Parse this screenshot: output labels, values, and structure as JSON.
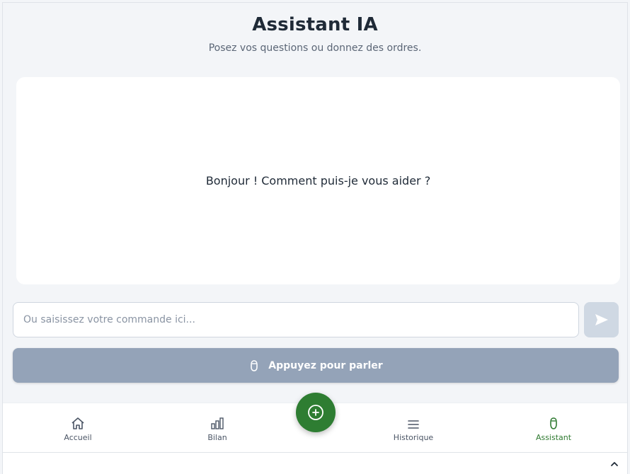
{
  "header": {
    "title": "Assistant IA",
    "subtitle": "Posez vos questions ou donnez des ordres."
  },
  "chat": {
    "greeting": "Bonjour ! Comment puis-je vous aider ?"
  },
  "command": {
    "placeholder": "Ou saisissez votre commande ici...",
    "value": "",
    "send_icon": "send-icon"
  },
  "voice": {
    "label": "Appuyez pour parler",
    "icon": "microphone-icon"
  },
  "nav": {
    "items": [
      {
        "label": "Accueil",
        "icon": "home-icon"
      },
      {
        "label": "Bilan",
        "icon": "bar-chart-icon"
      },
      {
        "label": "Historique",
        "icon": "menu-icon"
      },
      {
        "label": "Assistant",
        "icon": "microphone-icon"
      }
    ],
    "active": "Assistant",
    "fab_icon": "plus-circle-icon"
  },
  "colors": {
    "accent": "#2e7d32",
    "disabled_button": "#94a3b8",
    "background": "#f3f5f8"
  }
}
